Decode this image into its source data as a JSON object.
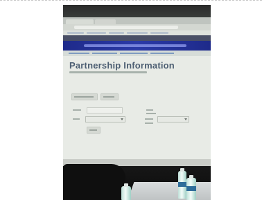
{
  "photo": {
    "scene": "projected-screen-in-meeting-room"
  },
  "screen": {
    "page_title": "Partnership Information"
  },
  "colors": {
    "banner": "#2b3aa8",
    "title": "#4c5e72",
    "taskbar": "#2c3b3a",
    "screen_bg": "#e8ebe6"
  },
  "taskbar": {
    "icons": [
      "start-icon",
      "file-explorer-icon",
      "browser-icon",
      "excel-icon",
      "app-icon"
    ]
  }
}
